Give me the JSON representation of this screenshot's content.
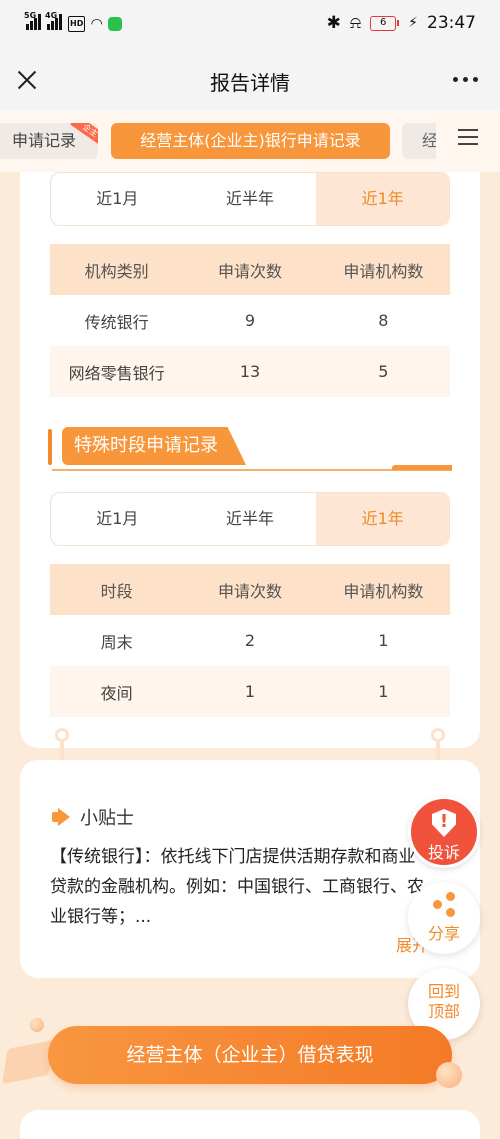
{
  "status_bar": {
    "signal1": "5G",
    "signal2": "4G",
    "hd": "HD",
    "battery": "6",
    "time": "23:47"
  },
  "header": {
    "title": "报告详情"
  },
  "tabs": {
    "prev": "申请记录",
    "prev_badge": "企主",
    "active": "经营主体(企业主)银行申请记录",
    "next": "经"
  },
  "period_tabs_1": [
    "近1月",
    "近半年",
    "近1年"
  ],
  "table_1": {
    "headers": [
      "机构类别",
      "申请次数",
      "申请机构数"
    ],
    "rows": [
      [
        "传统银行",
        "9",
        "8"
      ],
      [
        "网络零售银行",
        "13",
        "5"
      ]
    ]
  },
  "special_section": {
    "title": "特殊时段申请记录"
  },
  "period_tabs_2": [
    "近1月",
    "近半年",
    "近1年"
  ],
  "table_2": {
    "headers": [
      "时段",
      "申请次数",
      "申请机构数"
    ],
    "rows": [
      [
        "周末",
        "2",
        "1"
      ],
      [
        "夜间",
        "1",
        "1"
      ]
    ]
  },
  "tips": {
    "title": "小贴士",
    "body": "【传统银行】：依托线下门店提供活期存款和商业贷款的金融机构。例如：中国银行、工商银行、农业银行等；...",
    "expand": "展开"
  },
  "fabs": {
    "complain": "投诉",
    "share": "分享",
    "back_top_1": "回到",
    "back_top_2": "顶部"
  },
  "banner": {
    "label": "经营主体（企业主）借贷表现"
  },
  "colors": {
    "accent": "#f7963a",
    "accent_light": "#fde1c8",
    "complain": "#f0523c"
  }
}
